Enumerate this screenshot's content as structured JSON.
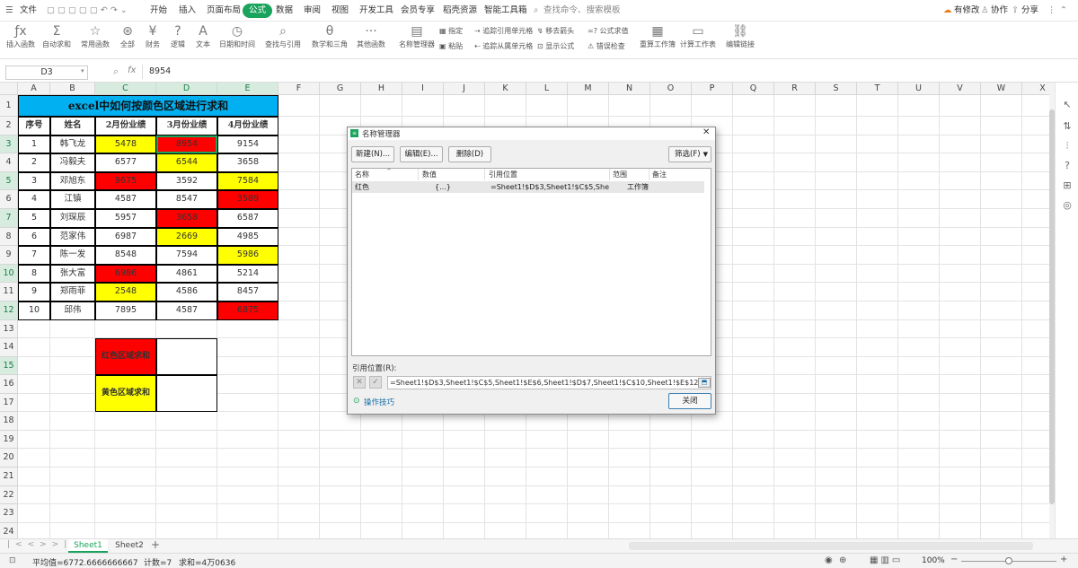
{
  "menubar": {
    "file": "文件",
    "tabs": [
      "开始",
      "插入",
      "页面布局",
      "公式",
      "数据",
      "审阅",
      "视图",
      "开发工具",
      "会员专享",
      "稻壳资源",
      "智能工具箱"
    ],
    "active_tab": "公式",
    "search": "查找命令、搜索模板",
    "changes": "有修改",
    "collab": "协作",
    "share": "分享"
  },
  "ribbon": {
    "buttons": [
      "插入函数",
      "自动求和",
      "常用函数",
      "全部",
      "财务",
      "逻辑",
      "文本",
      "日期和时间",
      "查找与引用",
      "数学和三角",
      "其他函数",
      "名称管理器",
      "重算工作簿",
      "计算工作表",
      "编辑链接"
    ],
    "small": [
      "指定",
      "粘贴",
      "追踪引用单元格",
      "追踪从属单元格",
      "移去箭头",
      "显示公式",
      "公式求值",
      "错误检查"
    ]
  },
  "formula_bar": {
    "cell_ref": "D3",
    "fx": "fx",
    "value": "8954"
  },
  "sheet": {
    "columns": [
      "A",
      "B",
      "C",
      "D",
      "E",
      "F",
      "G",
      "H",
      "I",
      "J",
      "K",
      "L",
      "M",
      "N",
      "O",
      "P",
      "Q",
      "R",
      "S",
      "T",
      "U",
      "V",
      "W",
      "X"
    ],
    "rows": [
      "1",
      "2",
      "3",
      "4",
      "5",
      "6",
      "7",
      "8",
      "9",
      "10",
      "11",
      "12",
      "13",
      "14",
      "15",
      "16",
      "17",
      "18",
      "19",
      "20",
      "21",
      "22",
      "23",
      "24"
    ],
    "title": "excel中如何按颜色区域进行求和",
    "headers": [
      "序号",
      "姓名",
      "2月份业绩",
      "3月份业绩",
      "4月份业绩"
    ],
    "data": [
      [
        "1",
        "韩飞龙",
        "5478",
        "8954",
        "9154"
      ],
      [
        "2",
        "冯毅夫",
        "6577",
        "6544",
        "3658"
      ],
      [
        "3",
        "邓旭东",
        "9675",
        "3592",
        "7584"
      ],
      [
        "4",
        "江镇",
        "4587",
        "8547",
        "3589"
      ],
      [
        "5",
        "刘琛辰",
        "5957",
        "3658",
        "6587"
      ],
      [
        "6",
        "范家伟",
        "6987",
        "2669",
        "4985"
      ],
      [
        "7",
        "陈一发",
        "8548",
        "7594",
        "5986"
      ],
      [
        "8",
        "张大富",
        "6986",
        "4861",
        "5214"
      ],
      [
        "9",
        "郑雨菲",
        "2548",
        "4586",
        "8457"
      ],
      [
        "10",
        "邱伟",
        "7895",
        "4587",
        "6875"
      ]
    ],
    "red_sum_label": "红色区域求和",
    "yellow_sum_label": "黄色区域求和"
  },
  "colors": {
    "red": "#ff0000",
    "yellow": "#ffff00",
    "title_bg": "#00b0f0",
    "accent": "#1aa35c"
  },
  "dialog": {
    "title": "名称管理器",
    "new_btn": "新建(N)...",
    "edit_btn": "编辑(E)...",
    "delete_btn": "删除(D)",
    "filter_btn": "筛选(F)",
    "col_name": "名称",
    "col_value": "数值",
    "col_ref": "引用位置",
    "col_scope": "范围",
    "col_note": "备注",
    "row": {
      "name": "红色",
      "value": "{...}",
      "ref": "=Sheet1!$D$3,Sheet1!$C$5,She...",
      "scope": "工作簿"
    },
    "ref_label": "引用位置(R):",
    "ref_value": "=Sheet1!$D$3,Sheet1!$C$5,Sheet1!$E$6,Sheet1!$D$7,Sheet1!$C$10,Sheet1!$E$12,Sheet1!$C$1",
    "tips": "操作技巧",
    "close_btn": "关闭"
  },
  "tabs": {
    "sheet1": "Sheet1",
    "sheet2": "Sheet2"
  },
  "status": {
    "avg": "平均值=6772.6666666667",
    "count": "计数=7",
    "sum": "求和=4万0636",
    "zoom": "100%"
  }
}
